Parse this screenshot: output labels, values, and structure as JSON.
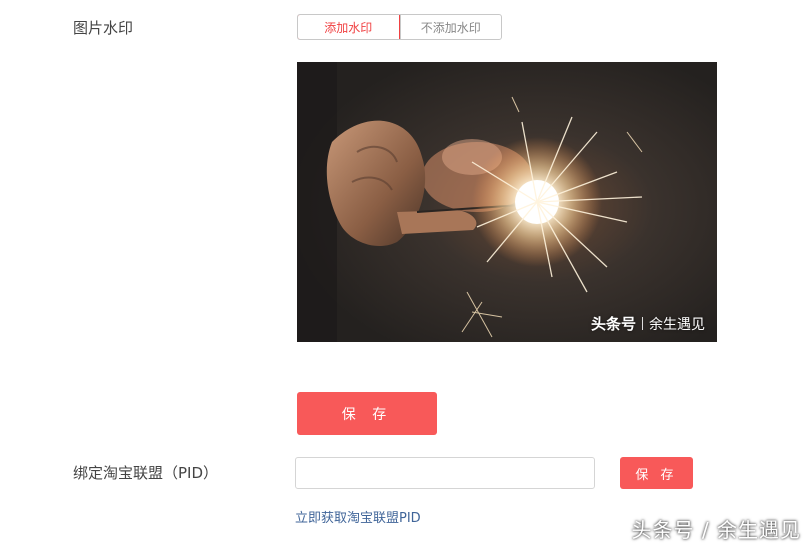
{
  "watermark_setting": {
    "label": "图片水印",
    "options": [
      "添加水印",
      "不添加水印"
    ],
    "selected": "添加水印",
    "accent": "#f04142"
  },
  "preview": {
    "watermark_brand": "头条号",
    "watermark_author": "余生遇见"
  },
  "save_button": {
    "label": "保 存",
    "color": "#f85959"
  },
  "pid": {
    "label": "绑定淘宝联盟（PID）",
    "input_value": "",
    "save_label": "保 存",
    "link_text": "立即获取淘宝联盟PID",
    "link_color": "#406599"
  },
  "page_watermark": "头条号 / 余生遇见"
}
